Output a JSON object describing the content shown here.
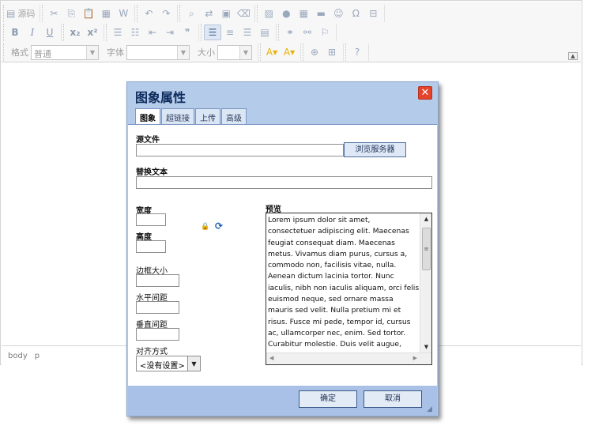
{
  "toolbar": {
    "row1": [
      {
        "name": "source-button",
        "icon": "source-icon",
        "glyph": "▤",
        "label": "源码"
      },
      {
        "name": "cut-button",
        "icon": "cut-icon",
        "glyph": "✂"
      },
      {
        "name": "copy-button",
        "icon": "copy-icon",
        "glyph": "⎘"
      },
      {
        "name": "paste-button",
        "icon": "paste-icon",
        "glyph": "📋"
      },
      {
        "name": "paste-text-button",
        "icon": "paste-text-icon",
        "glyph": "▦"
      },
      {
        "name": "paste-word-button",
        "icon": "paste-word-icon",
        "glyph": "W"
      },
      {
        "name": "undo-button",
        "icon": "undo-icon",
        "glyph": "↶"
      },
      {
        "name": "redo-button",
        "icon": "redo-icon",
        "glyph": "↷"
      },
      {
        "name": "find-button",
        "icon": "find-icon",
        "glyph": "⌕"
      },
      {
        "name": "replace-button",
        "icon": "replace-icon",
        "glyph": "⇄"
      },
      {
        "name": "select-all-button",
        "icon": "select-all-icon",
        "glyph": "▣"
      },
      {
        "name": "remove-format-button",
        "icon": "eraser-icon",
        "glyph": "⌫"
      },
      {
        "name": "image-button",
        "icon": "image-icon",
        "glyph": "▨"
      },
      {
        "name": "flash-button",
        "icon": "flash-icon",
        "glyph": "●"
      },
      {
        "name": "table-button",
        "icon": "table-icon",
        "glyph": "▦"
      },
      {
        "name": "horizontal-rule-button",
        "icon": "hr-icon",
        "glyph": "▬"
      },
      {
        "name": "smiley-button",
        "icon": "smiley-icon",
        "glyph": "☺"
      },
      {
        "name": "special-char-button",
        "icon": "omega-icon",
        "glyph": "Ω"
      },
      {
        "name": "page-break-button",
        "icon": "page-break-icon",
        "glyph": "⊟"
      }
    ],
    "row2": [
      {
        "name": "bold-button",
        "icon": "bold-icon",
        "glyph": "B",
        "cls": "bold"
      },
      {
        "name": "italic-button",
        "icon": "italic-icon",
        "glyph": "I",
        "cls": "italic"
      },
      {
        "name": "underline-button",
        "icon": "underline-icon",
        "glyph": "U",
        "cls": "under"
      },
      {
        "name": "subscript-button",
        "icon": "subscript-icon",
        "glyph": "x₂",
        "cls": "bold"
      },
      {
        "name": "superscript-button",
        "icon": "superscript-icon",
        "glyph": "x²",
        "cls": "bold"
      },
      {
        "name": "numbered-list-button",
        "icon": "numbered-list-icon",
        "glyph": "☰"
      },
      {
        "name": "bulleted-list-button",
        "icon": "bulleted-list-icon",
        "glyph": "☷"
      },
      {
        "name": "outdent-button",
        "icon": "outdent-icon",
        "glyph": "⇤"
      },
      {
        "name": "indent-button",
        "icon": "indent-icon",
        "glyph": "⇥"
      },
      {
        "name": "blockquote-button",
        "icon": "quote-icon",
        "glyph": "❞"
      },
      {
        "name": "align-left-button",
        "icon": "align-left-icon",
        "glyph": "☰",
        "cls": "active"
      },
      {
        "name": "align-center-button",
        "icon": "align-center-icon",
        "glyph": "≡"
      },
      {
        "name": "align-right-button",
        "icon": "align-right-icon",
        "glyph": "☰"
      },
      {
        "name": "justify-button",
        "icon": "justify-icon",
        "glyph": "▤"
      },
      {
        "name": "link-button",
        "icon": "link-icon",
        "glyph": "⚭"
      },
      {
        "name": "unlink-button",
        "icon": "unlink-icon",
        "glyph": "⚯"
      },
      {
        "name": "anchor-button",
        "icon": "flag-icon",
        "glyph": "⚐"
      }
    ],
    "row3": {
      "format_label": "格式",
      "format_value": "普通",
      "font_label": "字体",
      "font_value": "",
      "size_label": "大小",
      "size_value": "",
      "end_buttons": [
        {
          "name": "text-color-button",
          "icon": "text-color-icon",
          "glyph": "A▾",
          "cls": "colored-yellow"
        },
        {
          "name": "bg-color-button",
          "icon": "bg-color-icon",
          "glyph": "A▾",
          "cls": "colored-yellow"
        },
        {
          "name": "maximize-button",
          "icon": "maximize-icon",
          "glyph": "⊕"
        },
        {
          "name": "show-blocks-button",
          "icon": "show-blocks-icon",
          "glyph": "⊞"
        },
        {
          "name": "about-button",
          "icon": "help-icon",
          "glyph": "?"
        }
      ]
    },
    "collapse_glyph": "▲"
  },
  "statusbar": {
    "path": [
      "body",
      "p"
    ]
  },
  "dialog": {
    "title": "图象属性",
    "close_glyph": "✕",
    "tabs": [
      "图象",
      "超链接",
      "上传",
      "高级"
    ],
    "labels": {
      "source": "源文件",
      "browse": "浏览服务器",
      "alt": "替换文本",
      "width": "宽度",
      "height": "高度",
      "border": "边框大小",
      "hspace": "水平间距",
      "vspace": "垂直间距",
      "align": "对齐方式",
      "preview": "预览"
    },
    "values": {
      "source": "",
      "alt": "",
      "width": "",
      "height": "",
      "border": "",
      "hspace": "",
      "vspace": "",
      "align": "<没有设置>"
    },
    "lock_glyph": "🔒",
    "reset_glyph": "⟳",
    "preview_text": "Lorem ipsum dolor sit amet, consectetuer adipiscing elit. Maecenas feugiat consequat diam. Maecenas metus. Vivamus diam purus, cursus a, commodo non, facilisis vitae, nulla. Aenean dictum lacinia tortor. Nunc iaculis, nibh non iaculis aliquam, orci felis euismod neque, sed ornare massa mauris sed velit. Nulla pretium mi et risus. Fusce mi pede, tempor id, cursus ac, ullamcorper nec, enim. Sed tortor. Curabitur molestie. Duis velit augue, condimentum at, ultrices a, luctus ut, orci.",
    "ok": "确定",
    "cancel": "取消"
  }
}
